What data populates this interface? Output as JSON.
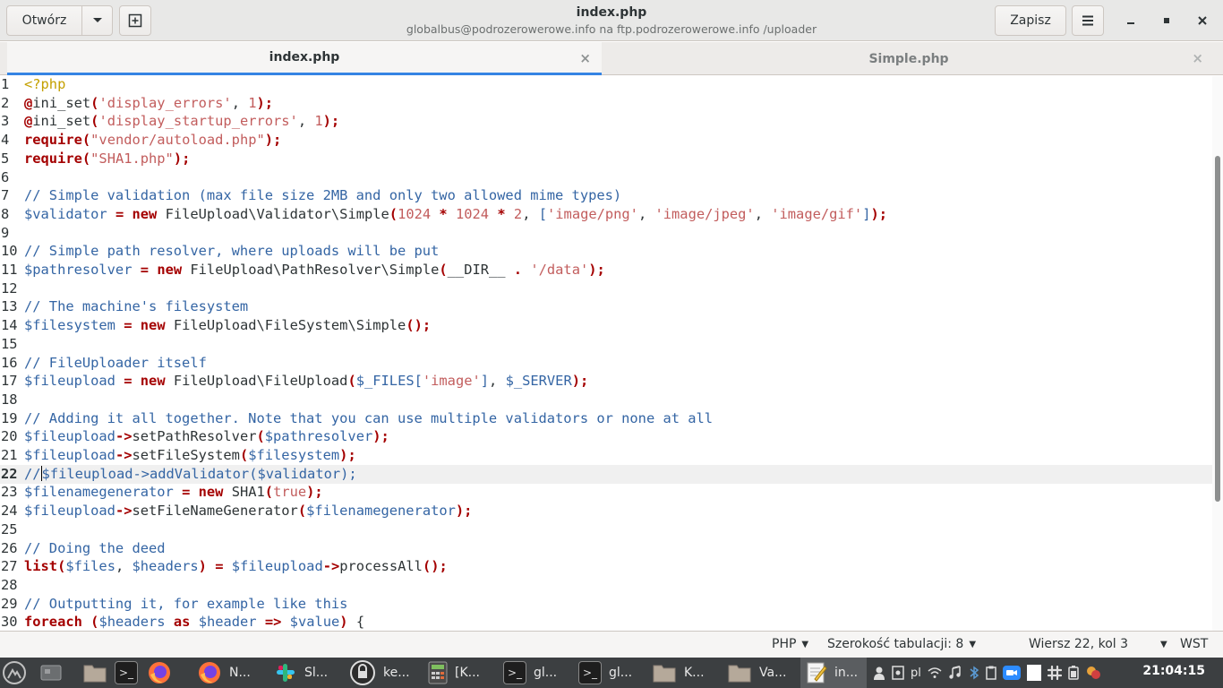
{
  "header": {
    "open_label": "Otwórz",
    "save_label": "Zapisz",
    "title": "index.php",
    "subtitle": "globalbus@podrozerowerowe.info na ftp.podrozerowerowe.info /uploader"
  },
  "tabs": [
    {
      "label": "index.php",
      "close": "×"
    },
    {
      "label": "Simple.php",
      "close": "×"
    }
  ],
  "code_lines": [
    {
      "n": "1",
      "tokens": [
        [
          "tag",
          "<?php"
        ]
      ]
    },
    {
      "n": "2",
      "tokens": [
        [
          "kw",
          "@"
        ],
        [
          "plain",
          "ini_set"
        ],
        [
          "op",
          "("
        ],
        [
          "str",
          "'display_errors'"
        ],
        [
          "plain",
          ", "
        ],
        [
          "num",
          "1"
        ],
        [
          "op",
          ");"
        ]
      ]
    },
    {
      "n": "3",
      "tokens": [
        [
          "kw",
          "@"
        ],
        [
          "plain",
          "ini_set"
        ],
        [
          "op",
          "("
        ],
        [
          "str",
          "'display_startup_errors'"
        ],
        [
          "plain",
          ", "
        ],
        [
          "num",
          "1"
        ],
        [
          "op",
          ");"
        ]
      ]
    },
    {
      "n": "4",
      "tokens": [
        [
          "kw",
          "require"
        ],
        [
          "op",
          "("
        ],
        [
          "str",
          "\"vendor/autoload.php\""
        ],
        [
          "op",
          ");"
        ]
      ]
    },
    {
      "n": "5",
      "tokens": [
        [
          "kw",
          "require"
        ],
        [
          "op",
          "("
        ],
        [
          "str",
          "\"SHA1.php\""
        ],
        [
          "op",
          ");"
        ]
      ]
    },
    {
      "n": "6",
      "tokens": []
    },
    {
      "n": "7",
      "tokens": [
        [
          "cm",
          "// Simple validation (max file size 2MB and only two allowed mime types)"
        ]
      ]
    },
    {
      "n": "8",
      "tokens": [
        [
          "var",
          "$validator"
        ],
        [
          "plain",
          " "
        ],
        [
          "op",
          "="
        ],
        [
          "plain",
          " "
        ],
        [
          "kw",
          "new"
        ],
        [
          "plain",
          " FileUpload\\Validator\\Simple"
        ],
        [
          "op",
          "("
        ],
        [
          "num",
          "1024"
        ],
        [
          "plain",
          " "
        ],
        [
          "op",
          "*"
        ],
        [
          "plain",
          " "
        ],
        [
          "num",
          "1024"
        ],
        [
          "plain",
          " "
        ],
        [
          "op",
          "*"
        ],
        [
          "plain",
          " "
        ],
        [
          "num",
          "2"
        ],
        [
          "plain",
          ", "
        ],
        [
          "var",
          "["
        ],
        [
          "str",
          "'image/png'"
        ],
        [
          "plain",
          ", "
        ],
        [
          "str",
          "'image/jpeg'"
        ],
        [
          "plain",
          ", "
        ],
        [
          "str",
          "'image/gif'"
        ],
        [
          "var",
          "]"
        ],
        [
          "op",
          ");"
        ]
      ]
    },
    {
      "n": "9",
      "tokens": []
    },
    {
      "n": "10",
      "tokens": [
        [
          "cm",
          "// Simple path resolver, where uploads will be put"
        ]
      ]
    },
    {
      "n": "11",
      "tokens": [
        [
          "var",
          "$pathresolver"
        ],
        [
          "plain",
          " "
        ],
        [
          "op",
          "="
        ],
        [
          "plain",
          " "
        ],
        [
          "kw",
          "new"
        ],
        [
          "plain",
          " FileUpload\\PathResolver\\Simple"
        ],
        [
          "op",
          "("
        ],
        [
          "plain",
          "__DIR__ "
        ],
        [
          "op",
          "."
        ],
        [
          "plain",
          " "
        ],
        [
          "str",
          "'/data'"
        ],
        [
          "op",
          ");"
        ]
      ]
    },
    {
      "n": "12",
      "tokens": []
    },
    {
      "n": "13",
      "tokens": [
        [
          "cm",
          "// The machine's filesystem"
        ]
      ]
    },
    {
      "n": "14",
      "tokens": [
        [
          "var",
          "$filesystem"
        ],
        [
          "plain",
          " "
        ],
        [
          "op",
          "="
        ],
        [
          "plain",
          " "
        ],
        [
          "kw",
          "new"
        ],
        [
          "plain",
          " FileUpload\\FileSystem\\Simple"
        ],
        [
          "op",
          "();"
        ]
      ]
    },
    {
      "n": "15",
      "tokens": []
    },
    {
      "n": "16",
      "tokens": [
        [
          "cm",
          "// FileUploader itself"
        ]
      ]
    },
    {
      "n": "17",
      "tokens": [
        [
          "var",
          "$fileupload"
        ],
        [
          "plain",
          " "
        ],
        [
          "op",
          "="
        ],
        [
          "plain",
          " "
        ],
        [
          "kw",
          "new"
        ],
        [
          "plain",
          " FileUpload\\FileUpload"
        ],
        [
          "op",
          "("
        ],
        [
          "var",
          "$_FILES["
        ],
        [
          "str",
          "'image'"
        ],
        [
          "var",
          "]"
        ],
        [
          "plain",
          ", "
        ],
        [
          "var",
          "$_SERVER"
        ],
        [
          "op",
          ");"
        ]
      ]
    },
    {
      "n": "18",
      "tokens": []
    },
    {
      "n": "19",
      "tokens": [
        [
          "cm",
          "// Adding it all together. Note that you can use multiple validators or none at all"
        ]
      ]
    },
    {
      "n": "20",
      "tokens": [
        [
          "var",
          "$fileupload"
        ],
        [
          "op",
          "->"
        ],
        [
          "plain",
          "setPathResolver"
        ],
        [
          "op",
          "("
        ],
        [
          "var",
          "$pathresolver"
        ],
        [
          "op",
          ");"
        ]
      ]
    },
    {
      "n": "21",
      "tokens": [
        [
          "var",
          "$fileupload"
        ],
        [
          "op",
          "->"
        ],
        [
          "plain",
          "setFileSystem"
        ],
        [
          "op",
          "("
        ],
        [
          "var",
          "$filesystem"
        ],
        [
          "op",
          ");"
        ]
      ]
    },
    {
      "n": "22",
      "current": true,
      "tokens": [
        [
          "cm",
          "//"
        ],
        [
          "cursor",
          ""
        ],
        [
          "cm",
          "$fileupload->addValidator($validator);"
        ]
      ]
    },
    {
      "n": "23",
      "tokens": [
        [
          "var",
          "$filenamegenerator"
        ],
        [
          "plain",
          " "
        ],
        [
          "op",
          "="
        ],
        [
          "plain",
          " "
        ],
        [
          "kw",
          "new"
        ],
        [
          "plain",
          " SHA1"
        ],
        [
          "op",
          "("
        ],
        [
          "str",
          "true"
        ],
        [
          "op",
          ");"
        ]
      ]
    },
    {
      "n": "24",
      "tokens": [
        [
          "var",
          "$fileupload"
        ],
        [
          "op",
          "->"
        ],
        [
          "plain",
          "setFileNameGenerator"
        ],
        [
          "op",
          "("
        ],
        [
          "var",
          "$filenamegenerator"
        ],
        [
          "op",
          ");"
        ]
      ]
    },
    {
      "n": "25",
      "tokens": []
    },
    {
      "n": "26",
      "tokens": [
        [
          "cm",
          "// Doing the deed"
        ]
      ]
    },
    {
      "n": "27",
      "tokens": [
        [
          "kw",
          "list"
        ],
        [
          "op",
          "("
        ],
        [
          "var",
          "$files"
        ],
        [
          "plain",
          ", "
        ],
        [
          "var",
          "$headers"
        ],
        [
          "op",
          ")"
        ],
        [
          "plain",
          " "
        ],
        [
          "op",
          "="
        ],
        [
          "plain",
          " "
        ],
        [
          "var",
          "$fileupload"
        ],
        [
          "op",
          "->"
        ],
        [
          "plain",
          "processAll"
        ],
        [
          "op",
          "();"
        ]
      ]
    },
    {
      "n": "28",
      "tokens": []
    },
    {
      "n": "29",
      "tokens": [
        [
          "cm",
          "// Outputting it, for example like this"
        ]
      ]
    },
    {
      "n": "30",
      "tokens": [
        [
          "kw",
          "foreach"
        ],
        [
          "plain",
          " "
        ],
        [
          "op",
          "("
        ],
        [
          "var",
          "$headers"
        ],
        [
          "plain",
          " "
        ],
        [
          "kw",
          "as"
        ],
        [
          "plain",
          " "
        ],
        [
          "var",
          "$header"
        ],
        [
          "plain",
          " "
        ],
        [
          "op",
          "=>"
        ],
        [
          "plain",
          " "
        ],
        [
          "var",
          "$value"
        ],
        [
          "op",
          ")"
        ],
        [
          "plain",
          " {"
        ]
      ]
    }
  ],
  "statusbar": {
    "language": "PHP",
    "tab_width": "Szerokość tabulacji: 8",
    "position": "Wiersz 22, kol 3",
    "insert_mode": "WST"
  },
  "taskbar": {
    "tasks": [
      {
        "icon": "terminal-icon",
        "label": ""
      },
      {
        "icon": "firefox-icon",
        "label": ""
      },
      {
        "icon": "firefox-icon",
        "label": "N..."
      },
      {
        "icon": "slack-icon",
        "label": "Sl..."
      },
      {
        "icon": "keepass-icon",
        "label": "ke..."
      },
      {
        "icon": "calculator-icon",
        "label": "[K..."
      },
      {
        "icon": "terminal-icon",
        "label": "gl..."
      },
      {
        "icon": "terminal-icon",
        "label": "gl..."
      },
      {
        "icon": "folder-icon",
        "label": "K..."
      },
      {
        "icon": "folder-icon",
        "label": "Va..."
      },
      {
        "icon": "text-editor-icon",
        "label": "in..."
      }
    ],
    "keyboard_layout": "pl",
    "clock": "21:04:15"
  }
}
